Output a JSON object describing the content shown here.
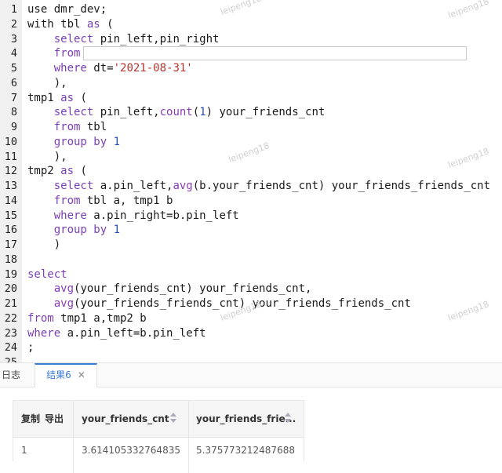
{
  "editor": {
    "lines": [
      {
        "n": "1",
        "tokens": [
          {
            "t": "use dmr_dev;",
            "c": ""
          }
        ]
      },
      {
        "n": "2",
        "tokens": [
          {
            "t": "with tbl ",
            "c": ""
          },
          {
            "t": "as",
            "c": "kw"
          },
          {
            "t": " (",
            "c": ""
          }
        ]
      },
      {
        "n": "3",
        "tokens": [
          {
            "t": "    ",
            "c": ""
          },
          {
            "t": "select",
            "c": "kw"
          },
          {
            "t": " pin_left,pin_right",
            "c": ""
          }
        ]
      },
      {
        "n": "4",
        "tokens": [
          {
            "t": "    ",
            "c": ""
          },
          {
            "t": "from",
            "c": "kw"
          }
        ],
        "redacted": true
      },
      {
        "n": "5",
        "tokens": [
          {
            "t": "    ",
            "c": ""
          },
          {
            "t": "where",
            "c": "kw"
          },
          {
            "t": " dt=",
            "c": ""
          },
          {
            "t": "'2021-08-31'",
            "c": "str"
          }
        ]
      },
      {
        "n": "6",
        "tokens": [
          {
            "t": "    ),",
            "c": ""
          }
        ]
      },
      {
        "n": "7",
        "tokens": [
          {
            "t": "tmp1 ",
            "c": ""
          },
          {
            "t": "as",
            "c": "kw"
          },
          {
            "t": " (",
            "c": ""
          }
        ]
      },
      {
        "n": "8",
        "tokens": [
          {
            "t": "    ",
            "c": ""
          },
          {
            "t": "select",
            "c": "kw"
          },
          {
            "t": " pin_left,",
            "c": ""
          },
          {
            "t": "count",
            "c": "fn"
          },
          {
            "t": "(",
            "c": ""
          },
          {
            "t": "1",
            "c": "num"
          },
          {
            "t": ") your_friends_cnt",
            "c": ""
          }
        ]
      },
      {
        "n": "9",
        "tokens": [
          {
            "t": "    ",
            "c": ""
          },
          {
            "t": "from",
            "c": "kw"
          },
          {
            "t": " tbl",
            "c": ""
          }
        ]
      },
      {
        "n": "10",
        "tokens": [
          {
            "t": "    ",
            "c": ""
          },
          {
            "t": "group by",
            "c": "kw"
          },
          {
            "t": " ",
            "c": ""
          },
          {
            "t": "1",
            "c": "num"
          }
        ]
      },
      {
        "n": "11",
        "tokens": [
          {
            "t": "    ),",
            "c": ""
          }
        ]
      },
      {
        "n": "12",
        "tokens": [
          {
            "t": "tmp2 ",
            "c": ""
          },
          {
            "t": "as",
            "c": "kw"
          },
          {
            "t": " (",
            "c": ""
          }
        ]
      },
      {
        "n": "13",
        "tokens": [
          {
            "t": "    ",
            "c": ""
          },
          {
            "t": "select",
            "c": "kw"
          },
          {
            "t": " a.pin_left,",
            "c": ""
          },
          {
            "t": "avg",
            "c": "fn"
          },
          {
            "t": "(b.your_friends_cnt) your_friends_friends_cnt",
            "c": ""
          }
        ]
      },
      {
        "n": "14",
        "tokens": [
          {
            "t": "    ",
            "c": ""
          },
          {
            "t": "from",
            "c": "kw"
          },
          {
            "t": " tbl a, tmp1 b",
            "c": ""
          }
        ]
      },
      {
        "n": "15",
        "tokens": [
          {
            "t": "    ",
            "c": ""
          },
          {
            "t": "where",
            "c": "kw"
          },
          {
            "t": " a.pin_right=b.pin_left",
            "c": ""
          }
        ]
      },
      {
        "n": "16",
        "tokens": [
          {
            "t": "    ",
            "c": ""
          },
          {
            "t": "group by",
            "c": "kw"
          },
          {
            "t": " ",
            "c": ""
          },
          {
            "t": "1",
            "c": "num"
          }
        ]
      },
      {
        "n": "17",
        "tokens": [
          {
            "t": "    )",
            "c": ""
          }
        ]
      },
      {
        "n": "18",
        "tokens": []
      },
      {
        "n": "19",
        "tokens": [
          {
            "t": "select",
            "c": "kw"
          }
        ]
      },
      {
        "n": "20",
        "tokens": [
          {
            "t": "    ",
            "c": ""
          },
          {
            "t": "avg",
            "c": "fn"
          },
          {
            "t": "(your_friends_cnt) your_friends_cnt,",
            "c": ""
          }
        ]
      },
      {
        "n": "21",
        "tokens": [
          {
            "t": "    ",
            "c": ""
          },
          {
            "t": "avg",
            "c": "fn"
          },
          {
            "t": "(your_friends_friends_cnt) your_friends_friends_cnt",
            "c": ""
          }
        ]
      },
      {
        "n": "22",
        "tokens": [
          {
            "t": "from",
            "c": "kw"
          },
          {
            "t": " tmp1 a,tmp2 b",
            "c": ""
          }
        ]
      },
      {
        "n": "23",
        "tokens": [
          {
            "t": "where",
            "c": "kw"
          },
          {
            "t": " a.pin_left=b.pin_left",
            "c": ""
          }
        ]
      },
      {
        "n": "24",
        "tokens": [
          {
            "t": ";",
            "c": ""
          }
        ]
      },
      {
        "n": "25",
        "tokens": []
      }
    ],
    "watermark": "leipeng18"
  },
  "tabs": [
    {
      "label": "日志",
      "active": false
    },
    {
      "label": "结果6",
      "active": true
    }
  ],
  "results": {
    "toolbar": {
      "copy": "复制",
      "export": "导出"
    },
    "columns": [
      "your_friends_cnt",
      "your_friends_frie..."
    ],
    "rows": [
      {
        "index": "1",
        "values": [
          "3.614105332764835",
          "5.375773212487688"
        ]
      }
    ]
  },
  "colors": {
    "accent": "#3a7bd5",
    "keyword": "#7a3fb4",
    "string": "#b8322c",
    "number": "#2a4fb0"
  }
}
